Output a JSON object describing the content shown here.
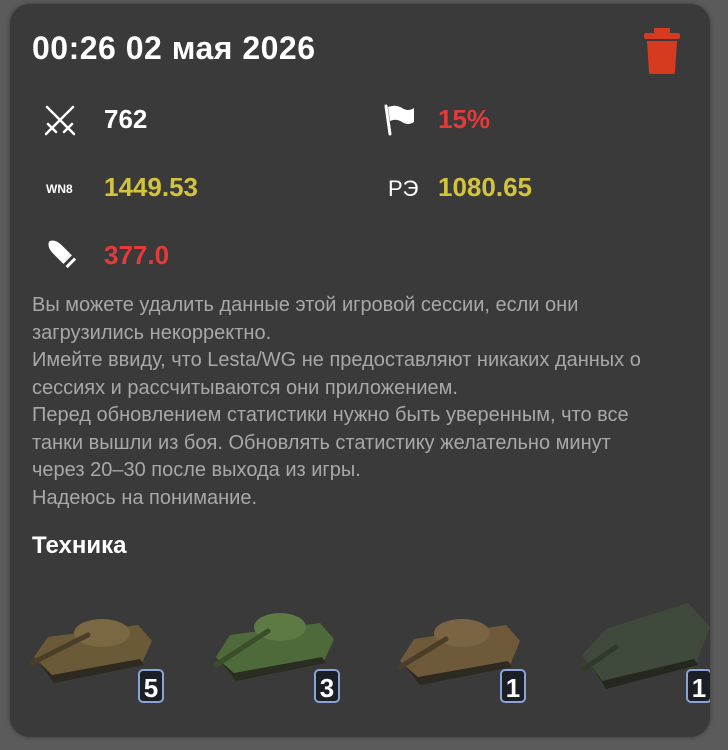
{
  "session": {
    "title": "00:26 02 мая 2026"
  },
  "stats": {
    "battles": {
      "icon": "crossed-swords-icon",
      "value": "762",
      "color": "#ffffff"
    },
    "winrate": {
      "icon": "flag-icon",
      "value": "15%",
      "color": "#e43a3a"
    },
    "wn8": {
      "label": "WN8",
      "value": "1449.53",
      "color": "#d4c43c"
    },
    "re": {
      "label": "РЭ",
      "value": "1080.65",
      "color": "#d4c43c"
    },
    "damage": {
      "icon": "shell-icon",
      "value": "377.0",
      "color": "#e43a3a"
    }
  },
  "description": [
    "Вы можете удалить данные этой игровой сессии, если они",
    "загрузились некорректно.",
    "Имейте ввиду, что Lesta/WG не предоставляют никаких данных о",
    "сессиях и рассчитываются они приложением.",
    "Перед обновлением статистики нужно быть уверенным, что все",
    "танки вышли из боя. Обновлять статистику желательно минут",
    "через 20–30 после выхода из игры.",
    "Надеюсь на понимание."
  ],
  "vehicles_section": {
    "title": "Техника",
    "tanks": [
      {
        "battles": "5",
        "hull_color": "#6b5a38"
      },
      {
        "battles": "3",
        "hull_color": "#4f6a3a"
      },
      {
        "battles": "1",
        "hull_color": "#6e5a3a"
      },
      {
        "battles": "1",
        "hull_color": "#3f4a3c"
      }
    ]
  },
  "colors": {
    "card": "#3a3a3a",
    "trash": "#d63a1f",
    "badge_border": "#8aa3d8"
  }
}
